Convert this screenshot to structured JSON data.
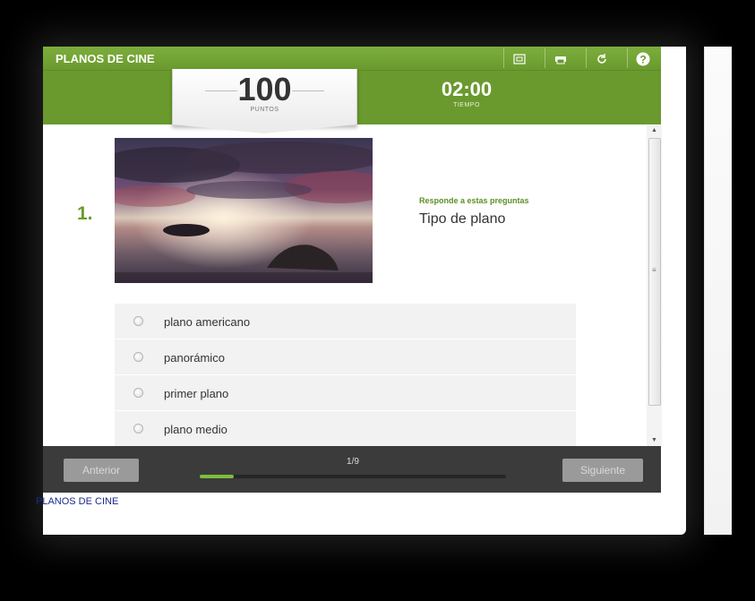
{
  "app": {
    "title": "PLANOS DE CINE",
    "toolbar": [
      "fullscreen-icon",
      "print-icon",
      "reload-icon",
      "help-icon"
    ]
  },
  "header": {
    "score": "100",
    "score_label": "PUNTOS",
    "time": "02:00",
    "time_label": "TIEMPO"
  },
  "question": {
    "number": "1.",
    "prompt": "Responde a estas preguntas",
    "text": "Tipo de plano",
    "options": [
      "plano americano",
      "panorámico",
      "primer plano",
      "plano medio"
    ]
  },
  "navigation": {
    "prev": "Anterior",
    "next": "Siguiente",
    "progress_text": "1/9",
    "progress_fraction": 0.111
  },
  "footer": {
    "link": "PLANOS DE CINE"
  },
  "colors": {
    "accent": "#6a9a2e",
    "progress": "#7cbf3b",
    "bottombar": "#3b3b3b"
  }
}
